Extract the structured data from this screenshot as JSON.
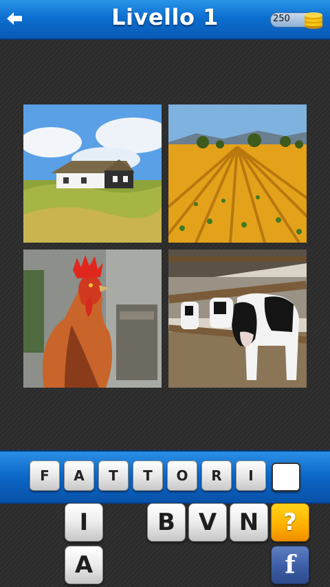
{
  "header": {
    "title": "Livello 1",
    "coins": "250"
  },
  "icons": {
    "back": "arrow-left-icon",
    "coins": "coin-stack-icon",
    "facebook": "facebook-icon"
  },
  "colors": {
    "header_blue": "#0d6fd0",
    "hint_yellow": "#ffb300",
    "facebook_blue": "#3d5ea6"
  },
  "photos": [
    {
      "subject": "house",
      "alt": "thatched farmhouse"
    },
    {
      "subject": "field",
      "alt": "plowed field"
    },
    {
      "subject": "rooster",
      "alt": "rooster"
    },
    {
      "subject": "cows",
      "alt": "cows behind fence"
    }
  ],
  "answer": {
    "letters": [
      "F",
      "A",
      "T",
      "T",
      "O",
      "R",
      "I",
      ""
    ]
  },
  "keyboard": {
    "row1": [
      "I",
      "",
      "",
      "B",
      "V",
      "N"
    ],
    "row2": [
      "A"
    ],
    "hint_label": "?",
    "facebook_label": "f"
  }
}
